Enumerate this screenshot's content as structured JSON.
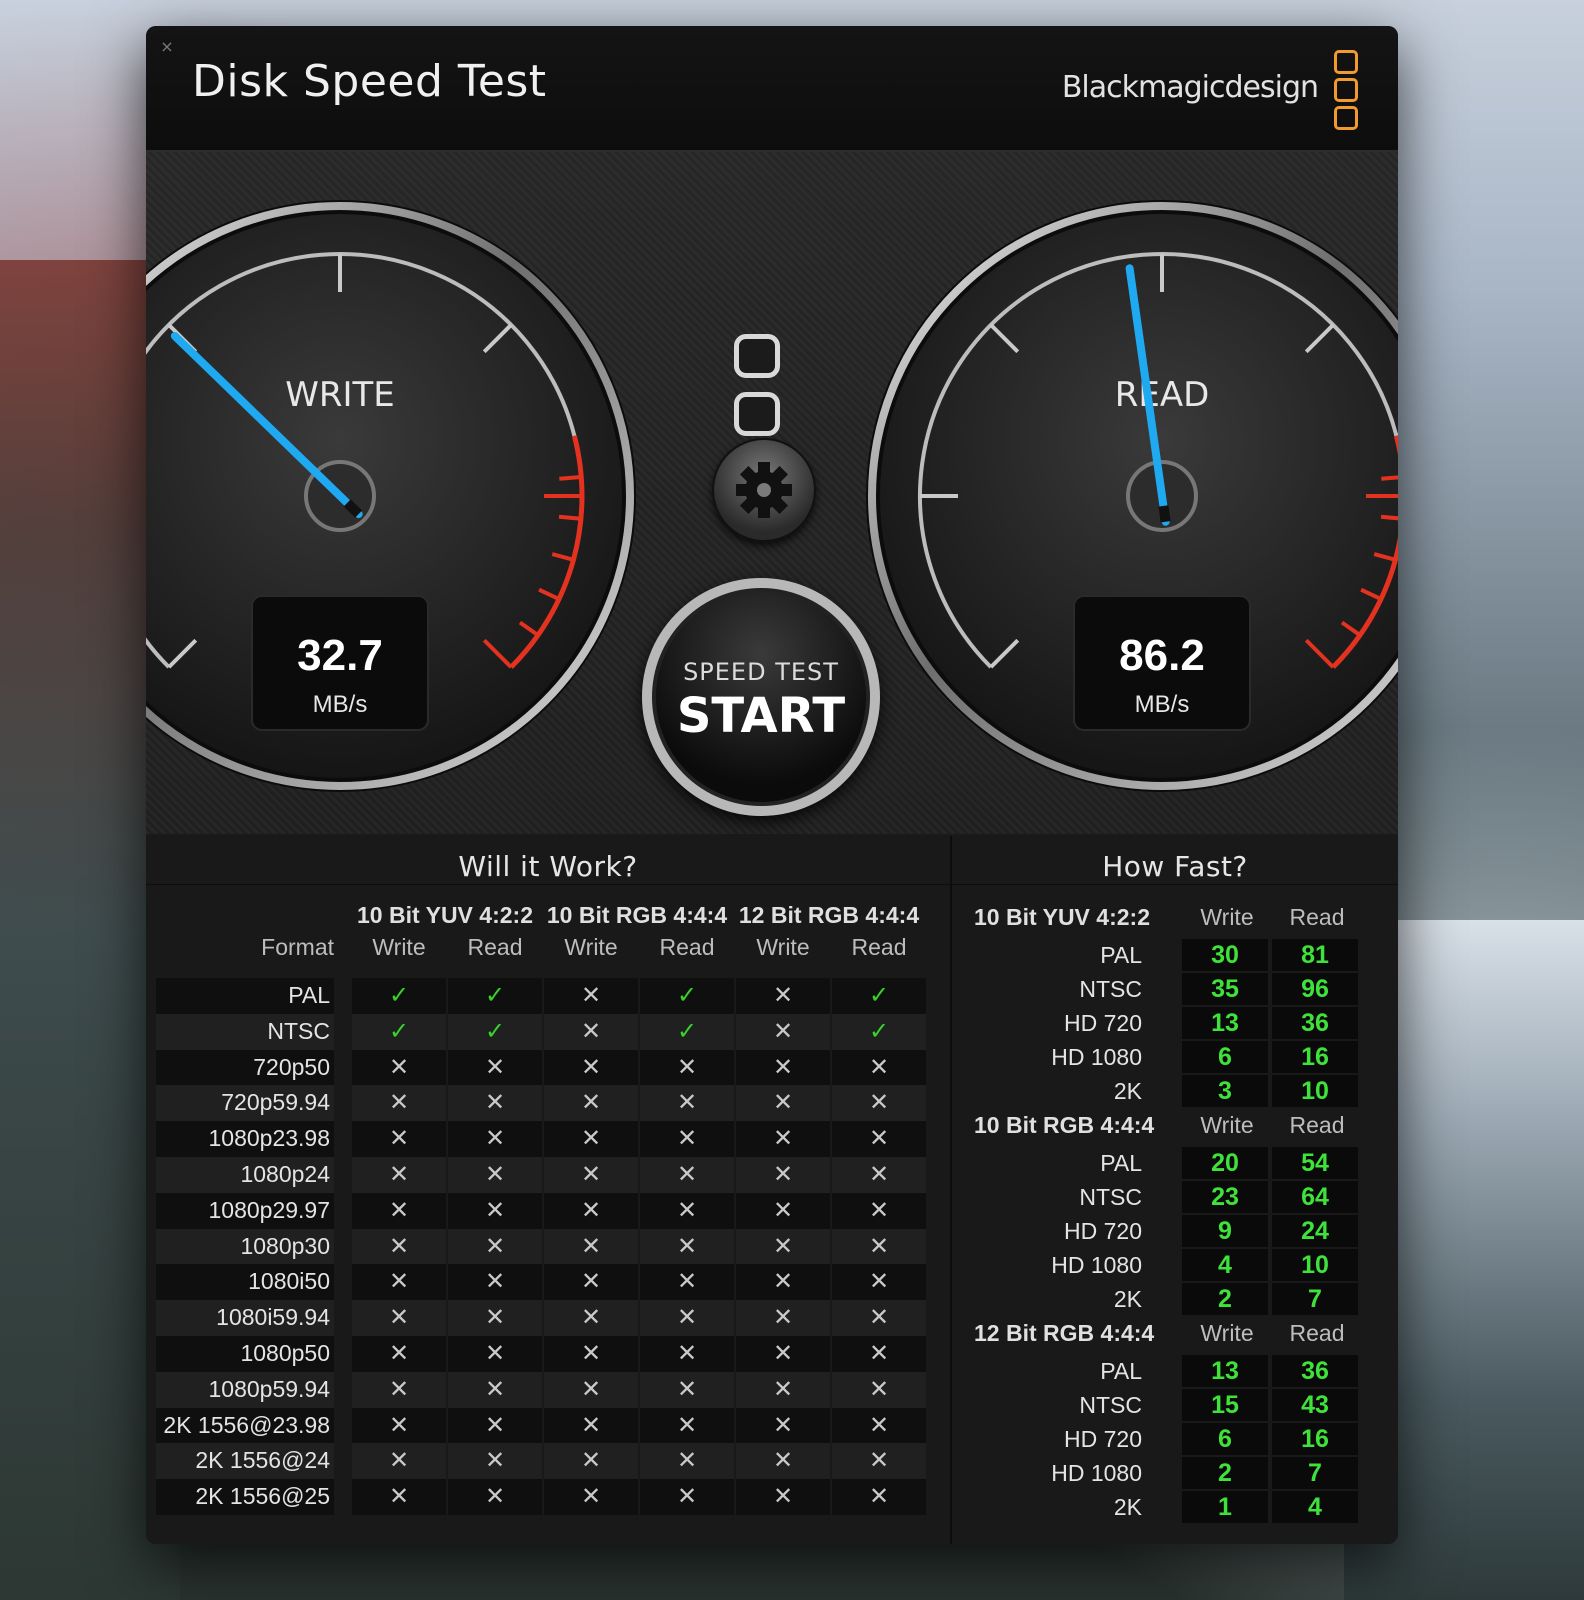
{
  "app": {
    "title": "Disk Speed Test",
    "brand": "Blackmagicdesign",
    "close_icon": "×"
  },
  "colors": {
    "needle": "#1fa9f0",
    "redline": "#e3321f",
    "brand_orange": "#f39a2e",
    "ok_green": "#36d22a",
    "value_green": "#3fe23a"
  },
  "gauges": {
    "write": {
      "label": "WRITE",
      "value": "32.7",
      "unit": "MB/s",
      "level": 0.33
    },
    "read": {
      "label": "READ",
      "value": "86.2",
      "unit": "MB/s",
      "level": 0.47
    }
  },
  "start_button": {
    "top_label": "SPEED TEST",
    "main_label": "START"
  },
  "settings_icon": "gear-icon",
  "will_it_work": {
    "title": "Will it Work?",
    "format_header": "Format",
    "groups": [
      "10 Bit YUV 4:2:2",
      "10 Bit RGB 4:4:4",
      "12 Bit RGB 4:4:4"
    ],
    "subheaders": [
      "Write",
      "Read",
      "Write",
      "Read",
      "Write",
      "Read"
    ],
    "ok_symbol": "✓",
    "no_symbol": "✕",
    "rows": [
      {
        "format": "PAL",
        "cells": [
          true,
          true,
          false,
          true,
          false,
          true
        ]
      },
      {
        "format": "NTSC",
        "cells": [
          true,
          true,
          false,
          true,
          false,
          true
        ]
      },
      {
        "format": "720p50",
        "cells": [
          false,
          false,
          false,
          false,
          false,
          false
        ]
      },
      {
        "format": "720p59.94",
        "cells": [
          false,
          false,
          false,
          false,
          false,
          false
        ]
      },
      {
        "format": "1080p23.98",
        "cells": [
          false,
          false,
          false,
          false,
          false,
          false
        ]
      },
      {
        "format": "1080p24",
        "cells": [
          false,
          false,
          false,
          false,
          false,
          false
        ]
      },
      {
        "format": "1080p29.97",
        "cells": [
          false,
          false,
          false,
          false,
          false,
          false
        ]
      },
      {
        "format": "1080p30",
        "cells": [
          false,
          false,
          false,
          false,
          false,
          false
        ]
      },
      {
        "format": "1080i50",
        "cells": [
          false,
          false,
          false,
          false,
          false,
          false
        ]
      },
      {
        "format": "1080i59.94",
        "cells": [
          false,
          false,
          false,
          false,
          false,
          false
        ]
      },
      {
        "format": "1080p50",
        "cells": [
          false,
          false,
          false,
          false,
          false,
          false
        ]
      },
      {
        "format": "1080p59.94",
        "cells": [
          false,
          false,
          false,
          false,
          false,
          false
        ]
      },
      {
        "format": "2K 1556@23.98",
        "cells": [
          false,
          false,
          false,
          false,
          false,
          false
        ]
      },
      {
        "format": "2K 1556@24",
        "cells": [
          false,
          false,
          false,
          false,
          false,
          false
        ]
      },
      {
        "format": "2K 1556@25",
        "cells": [
          false,
          false,
          false,
          false,
          false,
          false
        ]
      }
    ]
  },
  "how_fast": {
    "title": "How Fast?",
    "write_label": "Write",
    "read_label": "Read",
    "sections": [
      {
        "group": "10 Bit YUV 4:2:2",
        "rows": [
          {
            "label": "PAL",
            "write": "30",
            "read": "81"
          },
          {
            "label": "NTSC",
            "write": "35",
            "read": "96"
          },
          {
            "label": "HD 720",
            "write": "13",
            "read": "36"
          },
          {
            "label": "HD 1080",
            "write": "6",
            "read": "16"
          },
          {
            "label": "2K",
            "write": "3",
            "read": "10"
          }
        ]
      },
      {
        "group": "10 Bit RGB 4:4:4",
        "rows": [
          {
            "label": "PAL",
            "write": "20",
            "read": "54"
          },
          {
            "label": "NTSC",
            "write": "23",
            "read": "64"
          },
          {
            "label": "HD 720",
            "write": "9",
            "read": "24"
          },
          {
            "label": "HD 1080",
            "write": "4",
            "read": "10"
          },
          {
            "label": "2K",
            "write": "2",
            "read": "7"
          }
        ]
      },
      {
        "group": "12 Bit RGB 4:4:4",
        "rows": [
          {
            "label": "PAL",
            "write": "13",
            "read": "36"
          },
          {
            "label": "NTSC",
            "write": "15",
            "read": "43"
          },
          {
            "label": "HD 720",
            "write": "6",
            "read": "16"
          },
          {
            "label": "HD 1080",
            "write": "2",
            "read": "7"
          },
          {
            "label": "2K",
            "write": "1",
            "read": "4"
          }
        ]
      }
    ]
  }
}
